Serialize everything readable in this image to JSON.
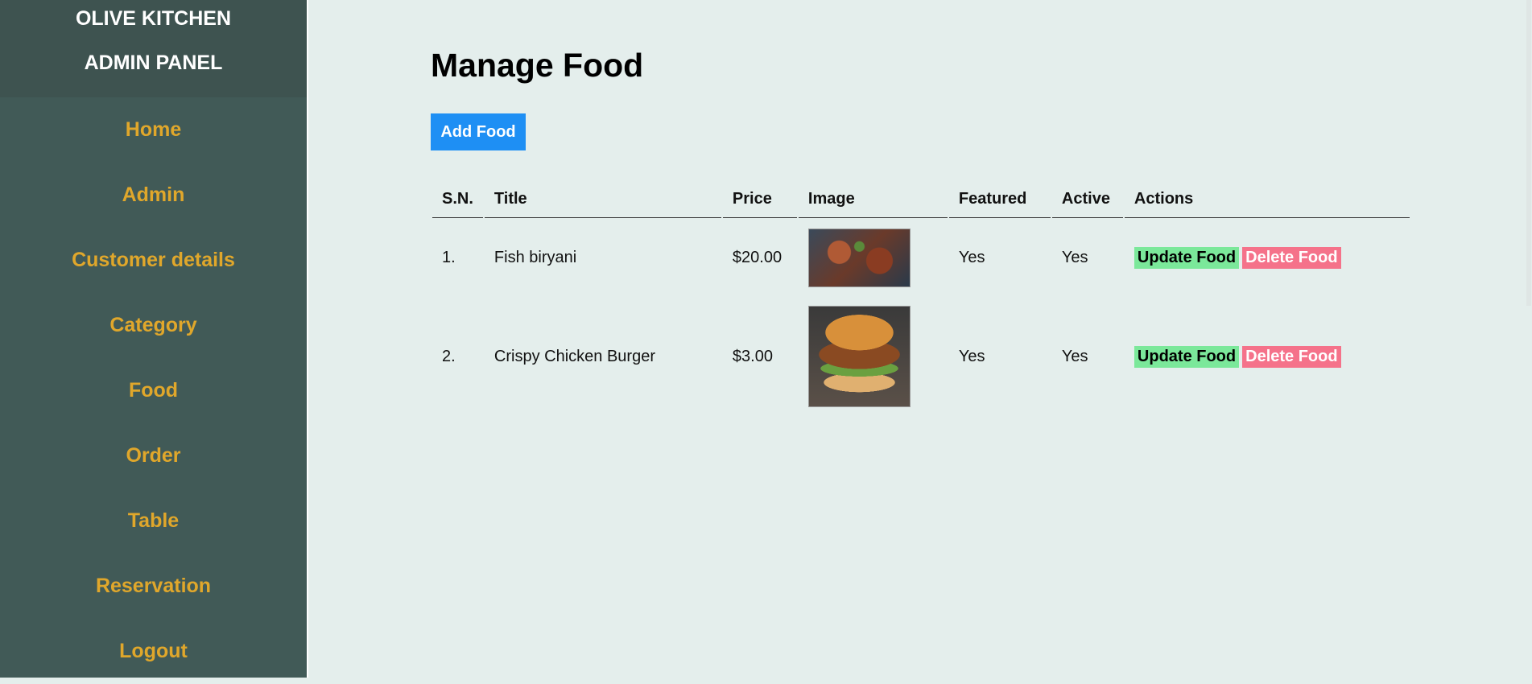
{
  "brand": {
    "line1": "OLIVE KITCHEN",
    "line2": "ADMIN PANEL"
  },
  "nav": [
    {
      "label": "Home"
    },
    {
      "label": "Admin"
    },
    {
      "label": "Customer details"
    },
    {
      "label": "Category"
    },
    {
      "label": "Food"
    },
    {
      "label": "Order"
    },
    {
      "label": "Table"
    },
    {
      "label": "Reservation"
    },
    {
      "label": "Logout"
    }
  ],
  "page": {
    "title": "Manage Food",
    "add_button": "Add Food"
  },
  "table": {
    "headers": [
      "S.N.",
      "Title",
      "Price",
      "Image",
      "Featured",
      "Active",
      "Actions"
    ],
    "rows": [
      {
        "sn": "1.",
        "title": "Fish biryani",
        "price": "$20.00",
        "featured": "Yes",
        "active": "Yes",
        "update": "Update Food",
        "delete": "Delete Food"
      },
      {
        "sn": "2.",
        "title": "Crispy Chicken Burger",
        "price": "$3.00",
        "featured": "Yes",
        "active": "Yes",
        "update": "Update Food",
        "delete": "Delete Food"
      }
    ]
  },
  "colors": {
    "sidebar": "#415a57",
    "nav_link": "#e0a72b",
    "add_button": "#1e8ff4",
    "update": "#7be89a",
    "delete": "#f5728a",
    "background": "#e4eeec"
  }
}
